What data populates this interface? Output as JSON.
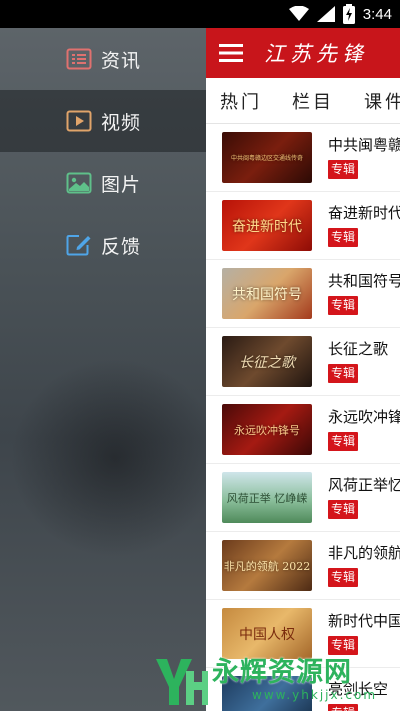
{
  "status_bar": {
    "time": "3:44",
    "icons": [
      "wifi-icon",
      "signal-icon",
      "battery-charging-icon"
    ]
  },
  "drawer": {
    "items": [
      {
        "label": "资讯",
        "icon": "news-list-icon",
        "active": false
      },
      {
        "label": "视频",
        "icon": "video-play-icon",
        "active": true
      },
      {
        "label": "图片",
        "icon": "picture-icon",
        "active": false
      },
      {
        "label": "反馈",
        "icon": "feedback-edit-icon",
        "active": false
      }
    ]
  },
  "header": {
    "brand": "江苏先锋",
    "menu_icon": "hamburger-menu-icon"
  },
  "tabs": [
    {
      "label": "热门"
    },
    {
      "label": "栏目"
    },
    {
      "label": "课件"
    }
  ],
  "videos": [
    {
      "title": "中共闽粤赣边区",
      "tag": "专辑",
      "thumb_text": "中共闽粤赣边区交通线传奇"
    },
    {
      "title": "奋进新时代",
      "tag": "专辑",
      "thumb_text": "奋进新时代"
    },
    {
      "title": "共和国符号",
      "tag": "专辑",
      "thumb_text": "共和国符号"
    },
    {
      "title": "长征之歌",
      "tag": "专辑",
      "thumb_text": "长征之歌"
    },
    {
      "title": "永远吹冲锋号",
      "tag": "专辑",
      "thumb_text": "永远吹冲锋号"
    },
    {
      "title": "风荷正举忆",
      "tag": "专辑",
      "thumb_text": "风荷正举 忆峥嵘"
    },
    {
      "title": "非凡的领航",
      "tag": "专辑",
      "thumb_text": "非凡的领航 2022"
    },
    {
      "title": "新时代中国",
      "tag": "专辑",
      "thumb_text": "中国人权"
    },
    {
      "title": "亮剑长空",
      "tag": "专辑",
      "thumb_text": ""
    }
  ],
  "watermark": {
    "cn": "永辉资源网",
    "url": "www.yhkjjx.com"
  },
  "colors": {
    "header_red": "#c8151b",
    "tag_red": "#d4151b",
    "drawer_bg": "#4a5257",
    "watermark_green": "#2db35d"
  }
}
